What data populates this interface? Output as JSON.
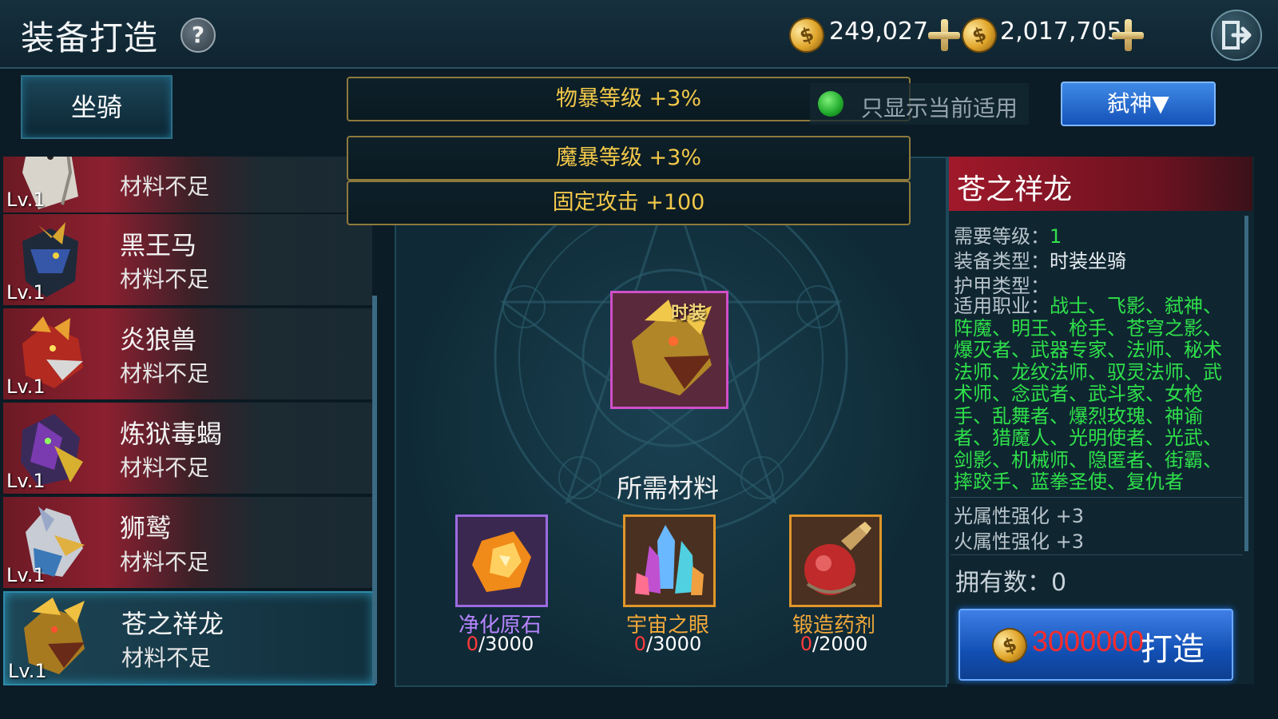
{
  "header": {
    "title": "装备打造",
    "help_icon": "?",
    "coin_icon": "$",
    "gold": "249,027",
    "bound_gold": "2,017,705"
  },
  "tabs": [
    {
      "label": "坐骑",
      "active": true
    }
  ],
  "bonuses": [
    "物暴等级 +3%",
    "魔暴等级 +3%",
    "固定攻击 +100"
  ],
  "filter": {
    "label": "只显示当前适用",
    "checked": true,
    "class_select": "弑神▼"
  },
  "mount_list": [
    {
      "name": "",
      "status": "材料不足",
      "level": "Lv.1"
    },
    {
      "name": "黑王马",
      "status": "材料不足",
      "level": "Lv.1"
    },
    {
      "name": "炎狼兽",
      "status": "材料不足",
      "level": "Lv.1"
    },
    {
      "name": "炼狱毒蝎",
      "status": "材料不足",
      "level": "Lv.1"
    },
    {
      "name": "狮鹫",
      "status": "材料不足",
      "level": "Lv.1"
    },
    {
      "name": "苍之祥龙",
      "status": "材料不足",
      "level": "Lv.1",
      "selected": true
    }
  ],
  "preview": {
    "tag": "时装"
  },
  "materials": {
    "title": "所需材料",
    "items": [
      {
        "name": "净化原石",
        "have": "0",
        "need": "/3000",
        "color": "#b784ff"
      },
      {
        "name": "宇宙之眼",
        "have": "0",
        "need": "/3000",
        "color": "#f2a93a"
      },
      {
        "name": "锻造药剂",
        "have": "0",
        "need": "/2000",
        "color": "#f2a93a"
      }
    ]
  },
  "detail": {
    "name": "苍之祥龙",
    "req_level_label": "需要等级：",
    "req_level": "1",
    "equip_type_label": "装备类型：",
    "equip_type": "时装坐骑",
    "armor_type_label": "护甲类型：",
    "classes_label": "适用职业：",
    "classes": "战士、飞影、弑神、阵魔、明王、枪手、苍穹之影、爆灭者、武器专家、法师、秘术法师、龙纹法师、驭灵法师、武术师、念武者、武斗家、女枪手、乱舞者、爆烈玫瑰、神谕者、猎魔人、光明使者、光武、剑影、机械师、隐匿者、街霸、摔跤手、蓝拳圣使、复仇者",
    "attributes": [
      "光属性强化 +3",
      "火属性强化 +3"
    ],
    "owned": "拥有数：0"
  },
  "forge_button": {
    "cost": "3000000",
    "label": "打造"
  },
  "colors": {
    "gold_text": "#f2c84a",
    "green_text": "#2fe04a",
    "cost_red": "#ff2a2a",
    "button_blue": "#1552b8"
  }
}
